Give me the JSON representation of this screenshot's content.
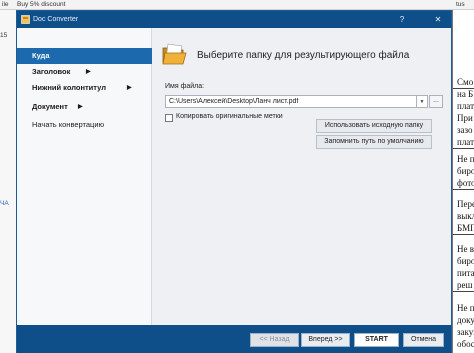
{
  "background_app": {
    "menu_fragments": [
      "ile",
      "Buy 5% discount",
      "tus"
    ],
    "left_fragments": [
      "15",
      "ЧА"
    ],
    "right_cells": [
      "Смо",
      "на Б",
      "плат",
      "При",
      "зазо",
      "плат",
      "Не п",
      "биро",
      "фото",
      "Пере",
      "выкл",
      "БМП",
      "Не в",
      "биро",
      "пита",
      "реш",
      "Не п",
      "доку",
      "закуп",
      "обос"
    ]
  },
  "window": {
    "title": "Doc Converter",
    "help_label": "?",
    "close_label": "✕"
  },
  "sidebar": {
    "items": [
      {
        "label": "Куда",
        "arrow": ""
      },
      {
        "label": "Заголовок",
        "arrow": "▶"
      },
      {
        "label": "Нижний колонтитул",
        "arrow": "▶"
      },
      {
        "label": "Документ",
        "arrow": "▶"
      },
      {
        "label": "Начать конвертацию",
        "arrow": ""
      }
    ]
  },
  "content": {
    "heading": "Выберите папку для результирующего файла",
    "file_label": "Имя файла:",
    "file_value": "C:\\Users\\Алексей\\Desktop\\Ланч лист.pdf",
    "browse_label": "...",
    "keep_marks_label": "Копировать оригинальные метки",
    "keep_marks_checked": false,
    "use_source_folder_label": "Использовать исходную папку",
    "remember_path_label": "Запомнить путь по умолчанию"
  },
  "footer": {
    "back_label": "<< Назад",
    "next_label": "Вперед >>",
    "start_label": "START",
    "cancel_label": "Отмена"
  },
  "colors": {
    "titlebar": "#0e4f8a",
    "active_nav": "#1c69ad",
    "dialog_bg": "#eef0f3"
  }
}
